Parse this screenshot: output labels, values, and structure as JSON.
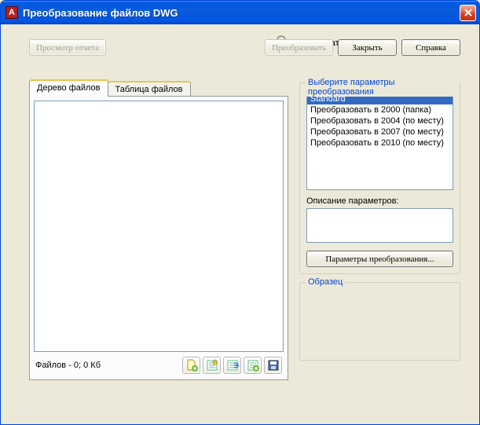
{
  "window": {
    "title": "Преобразование файлов DWG"
  },
  "user": {
    "label": "Пользователь: mihaylov"
  },
  "tabs": {
    "tree": "Дерево файлов",
    "table": "Таблица файлов"
  },
  "status": {
    "files": "Файлов - 0; 0 Кб"
  },
  "icons": {
    "add_file": "add-file",
    "new_list": "new-list",
    "reload": "reload",
    "append": "append",
    "save": "save"
  },
  "presets": {
    "legend": "Выберите параметры преобразования",
    "items": [
      "Standard",
      "Преобразовать в 2000 (папка)",
      "Преобразовать в 2004 (по месту)",
      "Преобразовать в 2007 (по месту)",
      "Преобразовать в 2010 (по месту)"
    ],
    "selected_index": 0,
    "desc_label": "Описание параметров:",
    "params_btn": "Параметры преобразования..."
  },
  "sample": {
    "legend": "Образец"
  },
  "buttons": {
    "report": "Просмотр отчета",
    "convert": "Преобразовать",
    "close": "Закрыть",
    "help": "Справка"
  }
}
